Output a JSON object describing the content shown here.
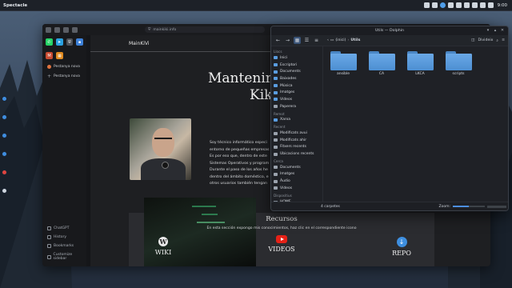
{
  "panel": {
    "app_name": "Spectacle",
    "clock": "9:00",
    "tray_icons": [
      "window-icon",
      "window-icon",
      "sync-icon",
      "shield-icon",
      "volume-icon",
      "network-icon",
      "bluetooth-icon",
      "battery-icon",
      "clipboard-icon"
    ]
  },
  "browser": {
    "url": "mainkiki.info",
    "pinned_icons": [
      "whatsapp-icon",
      "telegram-icon",
      "shield-icon",
      "app-icon",
      "gmail-icon",
      "calendar-icon"
    ],
    "tabs": [
      {
        "label": "Pestanya nova",
        "icon": "firefox-icon"
      },
      {
        "label": "Pestanya nova",
        "icon": "plus-icon"
      }
    ],
    "sidebar_footer": [
      "ChatGPT",
      "History",
      "Bookmarks",
      "Customize sidebar"
    ],
    "page": {
      "site_name": "MainKiVi",
      "hero_line1": "Mantenimie",
      "hero_line2": "Kike",
      "bio_lines": [
        "Soy técnico informático especi",
        "entorno de pequeñas empresas",
        "Es por eso que, dentro de este",
        "Sistemas Operativos y program",
        "Durante el paso de los años he",
        "dentro del ámbito doméstico, e",
        "otros usuarios también tengan"
      ],
      "resources_title": "Recursos",
      "resources_subtitle": "En esta sección expongo mis conocimientos, haz clic en el correspondiente icono",
      "resources": [
        {
          "label": "WIKI",
          "icon": "wikipedia-icon"
        },
        {
          "label": "VIDEOS",
          "icon": "youtube-icon"
        },
        {
          "label": "REPO",
          "icon": "download-icon"
        }
      ]
    }
  },
  "dolphin": {
    "title": "Utils — Dolphin",
    "breadcrumb": [
      "(inici)",
      "Utils"
    ],
    "split_label": "Divideix",
    "sections": [
      {
        "title": "Llocs",
        "items": [
          "Inici",
          "Escriptori",
          "Documents",
          "Baixades",
          "Música",
          "Imatges",
          "Vídeos",
          "Paperera"
        ]
      },
      {
        "title": "Remot",
        "items": [
          "Xarxa"
        ]
      },
      {
        "title": "Recent",
        "items": [
          "Modificats avui",
          "Modificats ahir",
          "Fitxers recents",
          "Ubicacions recents"
        ]
      },
      {
        "title": "Cerca",
        "items": [
          "Documents",
          "Imatges",
          "Àudio",
          "Vídeos"
        ]
      },
      {
        "title": "Dispositius",
        "items": [
          "HOME"
        ]
      }
    ],
    "folders": [
      "ansible",
      "CA",
      "LKCA",
      "scripts"
    ],
    "status_count": "4 carpetes",
    "zoom_label": "Zoom:",
    "zoom_level": 0.5
  }
}
